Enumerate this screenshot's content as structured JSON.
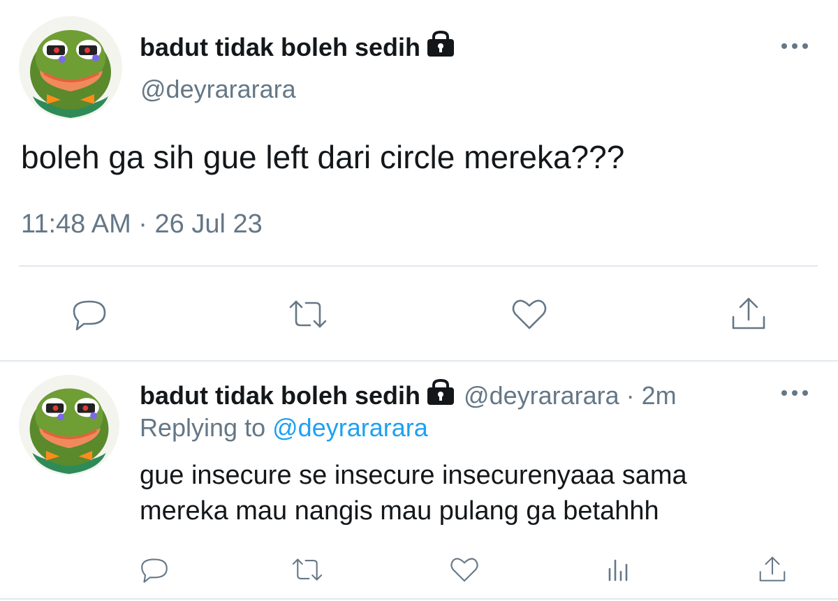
{
  "main_tweet": {
    "display_name": "badut tidak boleh sedih",
    "handle": "@deyrararara",
    "text": "boleh ga sih gue left dari circle mereka???",
    "timestamp": "11:48 AM · 26 Jul 23",
    "protected_icon": "lock-icon",
    "more_icon": "more-icon",
    "actions": [
      "reply-icon",
      "retweet-icon",
      "like-icon",
      "share-icon"
    ]
  },
  "reply_tweet": {
    "display_name": "badut tidak boleh sedih",
    "handle_time": "@deyrararara · 2m",
    "replying_prefix": "Replying to",
    "replying_to": "@deyrararara",
    "text_line1": "gue insecure se insecure insecurenyaaa sama",
    "text_line2": "mereka mau nangis mau pulang ga betahhh",
    "protected_icon": "lock-icon",
    "more_icon": "more-icon",
    "actions": [
      "reply-icon",
      "retweet-icon",
      "like-icon",
      "analytics-icon",
      "share-icon"
    ]
  },
  "colors": {
    "text": "#14171a",
    "secondary": "#657786",
    "link": "#1da1f2",
    "divider": "#e1e8ed"
  }
}
